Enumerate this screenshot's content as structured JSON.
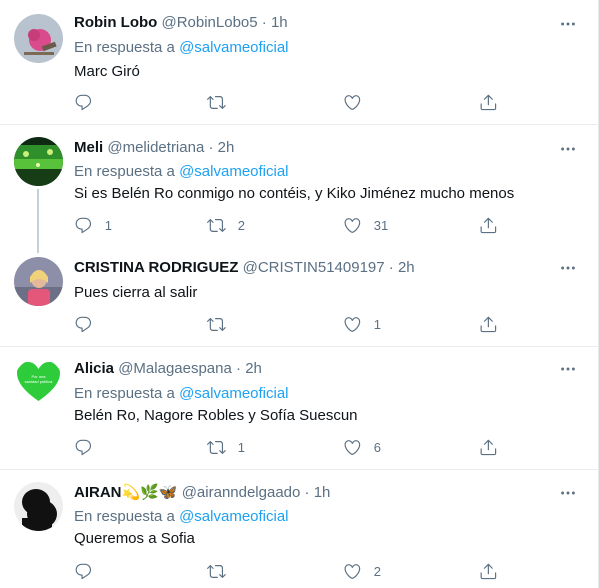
{
  "tweets": [
    {
      "name": "Robin Lobo",
      "name_suffix": "",
      "handle": "@RobinLobo5",
      "time": "1h",
      "reply_prefix": "En respuesta a",
      "mention": "@salvameoficial",
      "text": "Marc Giró",
      "replies": "",
      "retweets": "",
      "likes": "",
      "avatar": "bird-avatar"
    },
    {
      "name": "Meli",
      "name_suffix": "",
      "handle": "@melidetriana",
      "time": "2h",
      "reply_prefix": "En respuesta a",
      "mention": "@salvameoficial",
      "text": "Si es Belén Ro conmigo no contéis, y Kiko Jiménez mucho menos",
      "replies": "1",
      "retweets": "2",
      "likes": "31",
      "avatar": "green-landscape-avatar"
    },
    {
      "name": "CRISTINA RODRIGUEZ",
      "name_suffix": "",
      "handle": "@CRISTIN51409197",
      "time": "2h",
      "reply_prefix": "",
      "mention": "",
      "text": "Pues cierra al salir",
      "replies": "",
      "retweets": "",
      "likes": "1",
      "avatar": "woman-photo-avatar"
    },
    {
      "name": "Alicia",
      "name_suffix": "",
      "handle": "@Malagaespana",
      "time": "2h",
      "reply_prefix": "En respuesta a",
      "mention": "@salvameoficial",
      "text": "Belén Ro, Nagore Robles y Sofía Suescun",
      "replies": "",
      "retweets": "1",
      "likes": "6",
      "avatar": "green-heart-avatar"
    },
    {
      "name": "AIRAN",
      "name_suffix": "💫🌿🦋",
      "handle": "@airanndelgaado",
      "time": "1h",
      "reply_prefix": "En respuesta a",
      "mention": "@salvameoficial",
      "text": "Queremos a Sofia",
      "replies": "",
      "retweets": "",
      "likes": "2",
      "avatar": "black-silhouette-avatar"
    }
  ],
  "dot": "·",
  "colors": {
    "link": "#1da1f2",
    "secondary": "#5b7083",
    "divider": "#e6ecf0"
  }
}
